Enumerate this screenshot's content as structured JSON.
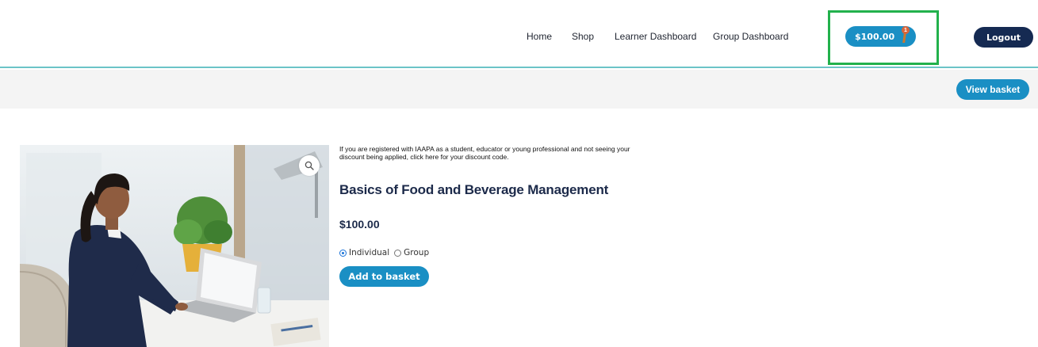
{
  "nav": {
    "home": "Home",
    "shop": "Shop",
    "learner_dashboard": "Learner Dashboard",
    "group_dashboard": "Group Dashboard"
  },
  "cart": {
    "total": "$100.00",
    "count": "1"
  },
  "logout_label": "Logout",
  "view_basket_label": "View basket",
  "product": {
    "discount_notice": "If you are registered with IAAPA as a student, educator or young professional and not seeing your discount being applied, click here for your discount code.",
    "title": "Basics of Food and Beverage Management",
    "price": "$100.00",
    "options": [
      {
        "label": "Individual",
        "selected": true
      },
      {
        "label": "Group",
        "selected": false
      }
    ],
    "add_to_basket_label": "Add to basket"
  },
  "icons": {
    "zoom": "magnifier-icon",
    "cart_badge": "cart-count-badge"
  },
  "colors": {
    "primary_button": "#1a8fc4",
    "logout_button": "#152a52",
    "highlight": "#22b14c",
    "header_border": "#6cc4c7",
    "title": "#1c2a4a"
  }
}
